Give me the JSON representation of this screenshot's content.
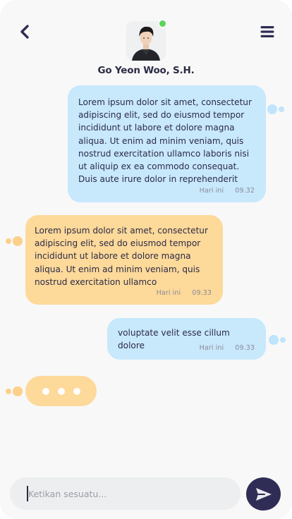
{
  "colors": {
    "background": "#f8f8f8",
    "outgoing_bubble": "#c8e8fc",
    "incoming_bubble": "#fdd99a",
    "outgoing_dot": "#bfe4fb",
    "incoming_dot": "#fcd08b",
    "online": "#5cd45c",
    "accent_dark": "#2f2d55",
    "input_bg": "#eceeef"
  },
  "header": {
    "back_icon": "chevron-left-icon",
    "menu_icon": "hamburger-menu-icon",
    "contact_name": "Go Yeon Woo, S.H.",
    "online": true
  },
  "messages": [
    {
      "direction": "outgoing",
      "text": "Lorem ipsum dolor sit amet, consectetur adipiscing elit, sed do eiusmod tempor incididunt ut labore et dolore magna aliqua. Ut enim ad minim veniam, quis nostrud exercitation ullamco laboris nisi ut aliquip ex ea commodo consequat. Duis aute irure dolor in reprehenderit",
      "day": "Hari ini",
      "time": "09.32"
    },
    {
      "direction": "incoming",
      "text": "Lorem ipsum dolor sit amet, consectetur adipiscing elit, sed do eiusmod tempor incididunt ut labore et dolore magna aliqua. Ut enim ad minim veniam, quis nostrud exercitation ullamco",
      "day": "Hari ini",
      "time": "09.33"
    },
    {
      "direction": "outgoing",
      "text": "voluptate velit esse cillum dolore",
      "day": "Hari ini",
      "time": "09.33"
    }
  ],
  "typing_indicator": {
    "visible": true,
    "direction": "incoming"
  },
  "composer": {
    "placeholder": "Ketikan sesuatu...",
    "value": "",
    "send_icon": "paper-plane-send-icon"
  }
}
